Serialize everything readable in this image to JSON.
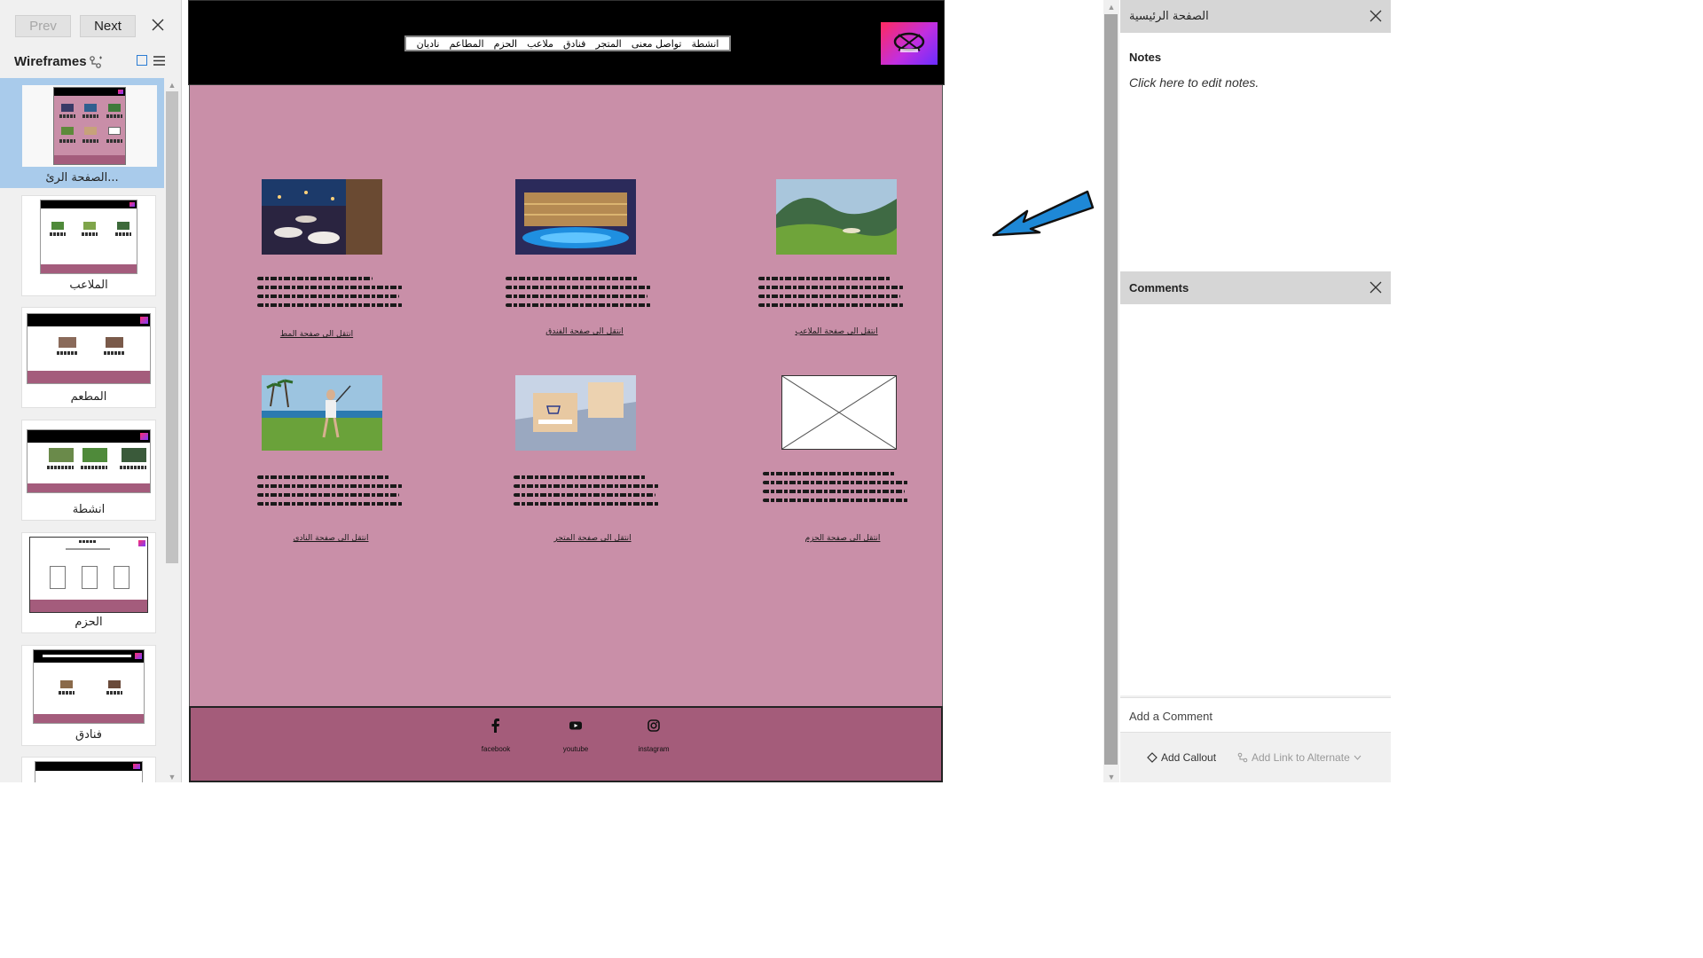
{
  "toolbar": {
    "prev_label": "Prev",
    "next_label": "Next"
  },
  "wireframes": {
    "title": "Wireframes",
    "items": [
      {
        "label": "...الصفحة الرئ"
      },
      {
        "label": "الملاعب"
      },
      {
        "label": "المطعم"
      },
      {
        "label": "انشطة"
      },
      {
        "label": "الحزم"
      },
      {
        "label": "فنادق"
      },
      {
        "label": ""
      }
    ]
  },
  "page": {
    "nav_items": [
      "ناديان",
      "المطاعم",
      "الحزم",
      "ملاعب",
      "فنادق",
      "المتجر",
      "تواصل معنى",
      "انشطة"
    ],
    "cards": [
      {
        "link": "انتقل الى صفحة المط"
      },
      {
        "link": "انتقل الى صفحة الفندق"
      },
      {
        "link": "انتقل الى صفحة الملاعب"
      },
      {
        "link": "انتقل الى صفحة النادي"
      },
      {
        "link": "انتقل الى صفحة المتجر"
      },
      {
        "link": "انتقل الى صفحة الحزم"
      }
    ],
    "footer": {
      "social": [
        {
          "icon": "facebook-icon",
          "label": "facebook"
        },
        {
          "icon": "youtube-icon",
          "label": "youtube"
        },
        {
          "icon": "instagram-icon",
          "label": "instagram"
        }
      ]
    },
    "colors": {
      "body": "#c98fa8",
      "footer": "#a45c7a",
      "header": "#000000",
      "arrow": "#1e88d6"
    }
  },
  "right_panel": {
    "page_title": "الصفحة الرئيسية",
    "notes_label": "Notes",
    "notes_placeholder": "Click here to edit notes.",
    "comments_label": "Comments",
    "add_comment": "Add a Comment",
    "add_callout": "Add Callout",
    "add_link": "Add Link to Alternate"
  }
}
